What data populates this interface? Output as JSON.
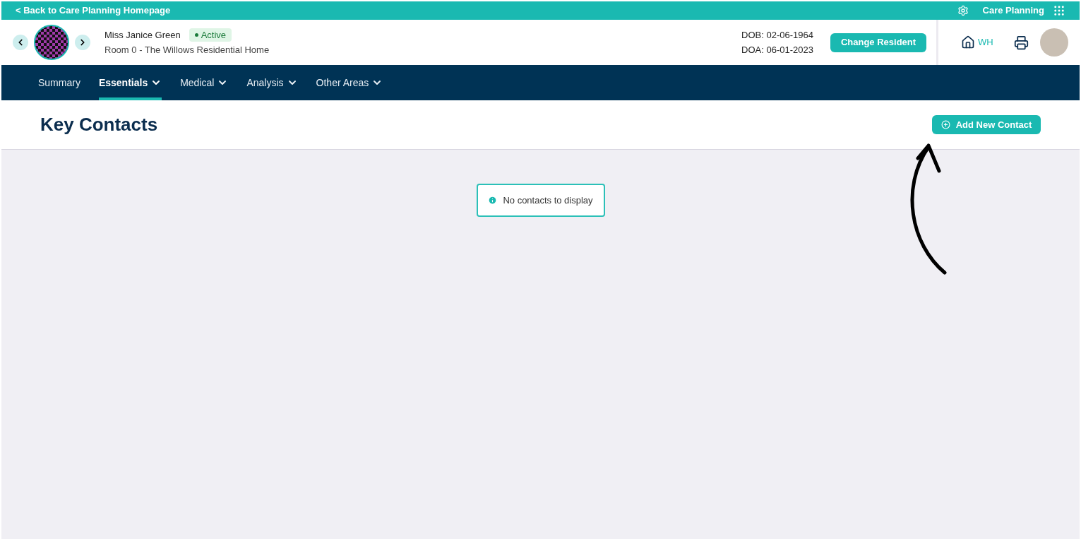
{
  "top_bar": {
    "back_link": "< Back to Care Planning Homepage",
    "app_name": "Care Planning"
  },
  "resident": {
    "name": "Miss Janice Green",
    "status": "Active",
    "status_active": true,
    "room": "Room 0 - The Willows Residential Home",
    "dob": "DOB: 02-06-1964",
    "doa": "DOA: 06-01-2023",
    "change_button": "Change Resident",
    "home_code": "WH"
  },
  "nav": [
    {
      "label": "Summary",
      "dropdown": false,
      "selected": false
    },
    {
      "label": "Essentials",
      "dropdown": true,
      "selected": true
    },
    {
      "label": "Medical",
      "dropdown": true,
      "selected": false
    },
    {
      "label": "Analysis",
      "dropdown": true,
      "selected": false
    },
    {
      "label": "Other Areas",
      "dropdown": true,
      "selected": false
    }
  ],
  "page": {
    "title": "Key Contacts",
    "add_button": "Add New Contact",
    "empty_message": "No contacts to display"
  }
}
